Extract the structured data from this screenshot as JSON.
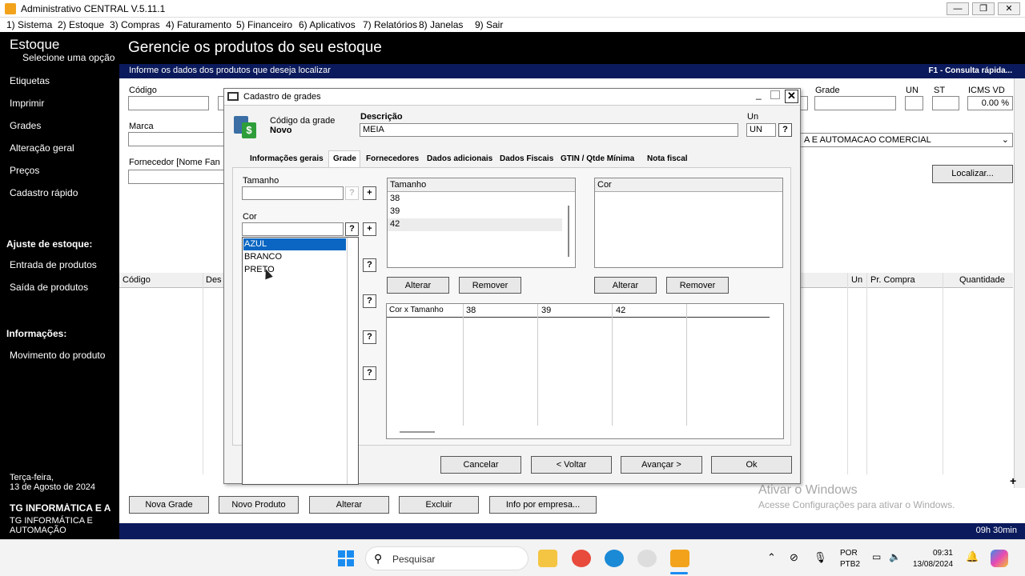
{
  "window": {
    "title": "Administrativo CENTRAL V.5.11.1"
  },
  "menu": [
    "1) Sistema",
    "2) Estoque",
    "3) Compras",
    "4) Faturamento",
    "5) Financeiro",
    "6) Aplicativos",
    "7) Relatórios",
    "8) Janelas",
    "9) Sair"
  ],
  "sidebar": {
    "title": "Estoque",
    "subtitle": "Selecione uma opção",
    "items": [
      "Etiquetas",
      "Imprimir",
      "Grades",
      "Alteração geral",
      "Preços",
      "Cadastro rápido"
    ],
    "section_ajuste": "Ajuste de estoque:",
    "ajuste_items": [
      "Entrada de produtos",
      "Saída de produtos"
    ],
    "section_info": "Informações:",
    "info_items": [
      "Movimento do produto"
    ],
    "date_day": "Terça-feira,",
    "date_full": "13 de Agosto de 2024",
    "company_bold": "TG INFORMÁTICA E A",
    "company_line1": "TG INFORMÁTICA E",
    "company_line2": "AUTOMAÇÃO"
  },
  "main": {
    "title": "Gerencie os produtos do seu estoque",
    "info": "Informe os dados dos produtos que deseja localizar",
    "help": "F1 - Consulta rápida...",
    "labels": {
      "codigo": "Código",
      "marca": "Marca",
      "fornecedor": "Fornecedor [Nome Fan",
      "grade": "Grade",
      "un": "UN",
      "st": "ST",
      "icms": "ICMS VD"
    },
    "icms_value": "0.00 %",
    "fornecedor_value": "A E AUTOMACAO COMERCIAL",
    "localizar": "Localizar...",
    "columns": [
      "Código",
      "Des",
      "Un",
      "Pr. Compra",
      "Quantidade"
    ],
    "buttons": [
      "Nova Grade",
      "Novo Produto",
      "Alterar",
      "Excluir",
      "Info por empresa..."
    ],
    "status_time": "09h 30min"
  },
  "dialog": {
    "title": "Cadastro de grades",
    "code_label": "Código da grade",
    "code_value": "Novo",
    "desc_label": "Descrição",
    "desc_value": "MEIA",
    "un_label": "Un",
    "un_value": "UN",
    "tabs": [
      "Informações gerais",
      "Grade",
      "Fornecedores",
      "Dados adicionais",
      "Dados Fiscais",
      "GTIN / Qtde Mínima",
      "Nota fiscal"
    ],
    "tamanho_label": "Tamanho",
    "cor_label": "Cor",
    "tamanho_list_header": "Tamanho",
    "tamanho_list": [
      "38",
      "39",
      "42"
    ],
    "cor_list_header": "Cor",
    "alterar": "Alterar",
    "remover": "Remover",
    "matrix_headers": [
      "Cor x Tamanho",
      "38",
      "39",
      "42"
    ],
    "buttons": {
      "cancel": "Cancelar",
      "back": "< Voltar",
      "next": "Avançar >",
      "ok": "Ok"
    }
  },
  "dropdown": {
    "options": [
      "AZUL",
      "BRANCO",
      "PRETO"
    ],
    "selected": "AZUL"
  },
  "watermark": {
    "line1": "Ativar o Windows",
    "line2": "Acesse Configurações para ativar o Windows."
  },
  "taskbar": {
    "search": "Pesquisar",
    "lang1": "POR",
    "lang2": "PTB2",
    "time": "09:31",
    "date": "13/08/2024"
  }
}
